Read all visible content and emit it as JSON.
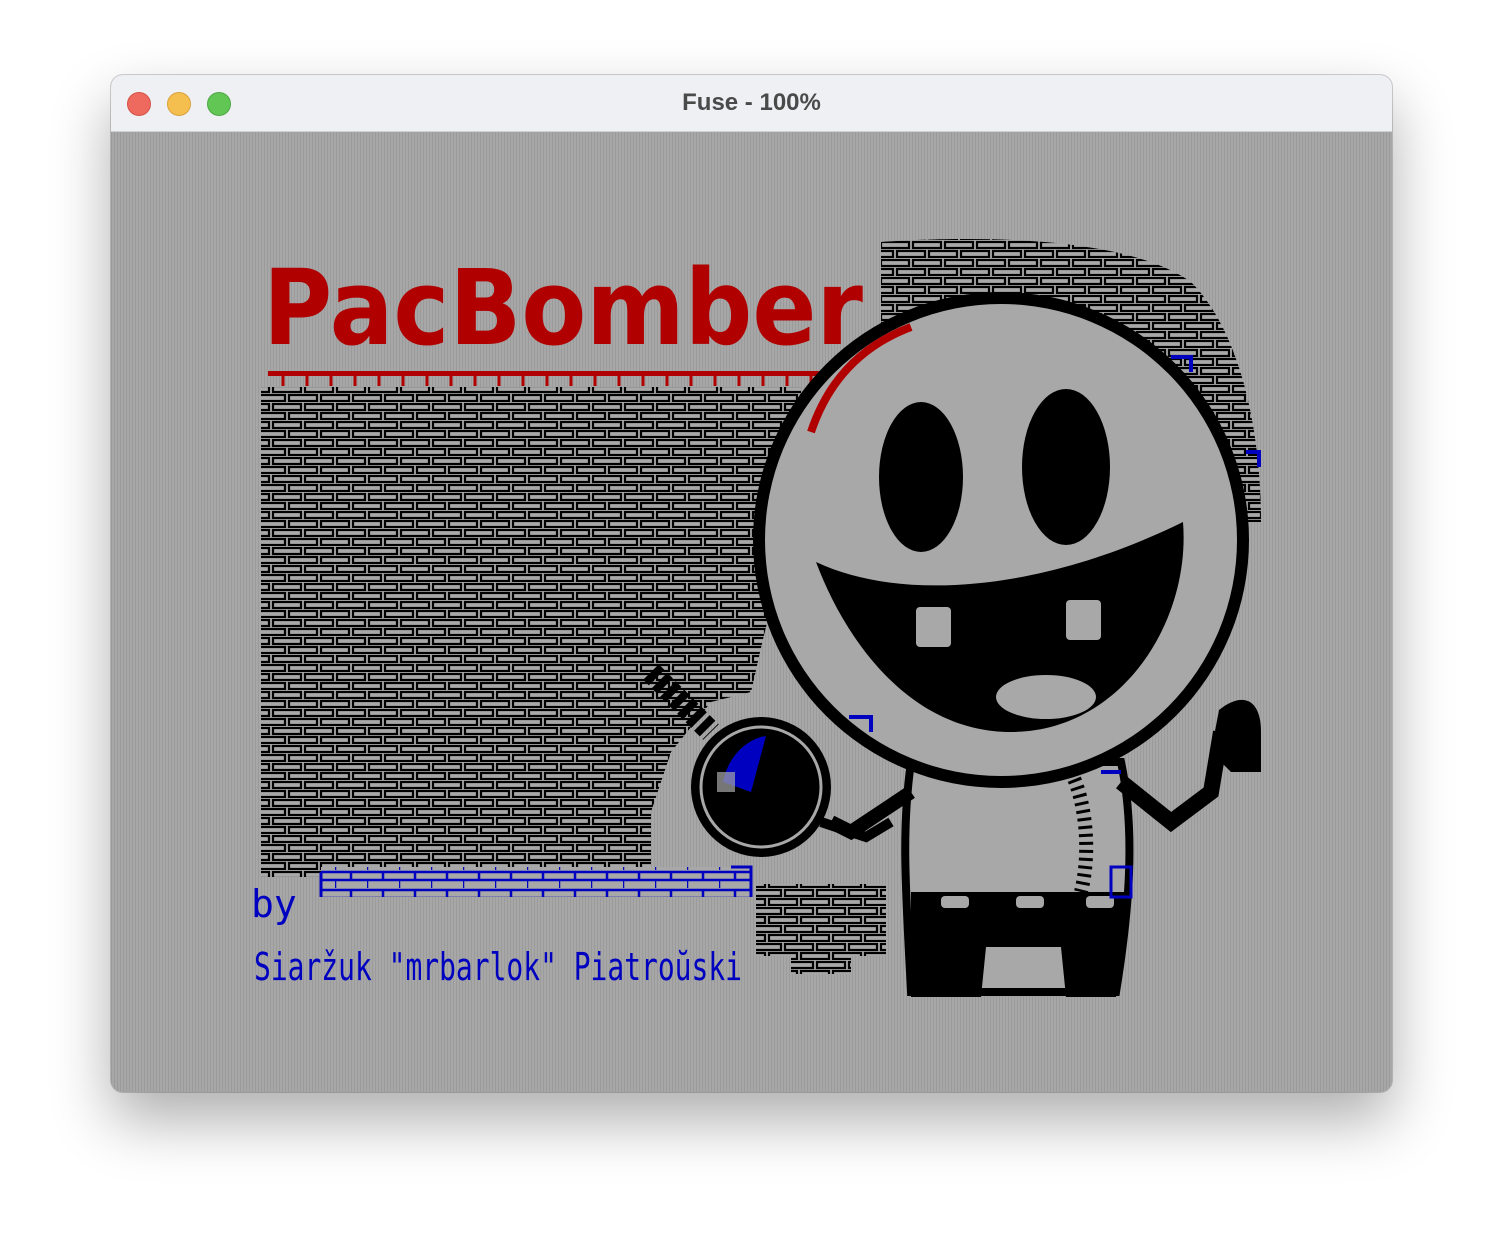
{
  "window": {
    "title": "Fuse - 100%",
    "buttons": [
      "close",
      "minimize",
      "maximize"
    ]
  },
  "game": {
    "title": "PacBomber",
    "byline": "by",
    "author": "Siaržuk \"mrbarlok\" Piatroŭski"
  },
  "colors": {
    "title_red": "#b00000",
    "author_blue": "#0000c0",
    "ink": "#000000",
    "paper": "#a8a8a8"
  }
}
